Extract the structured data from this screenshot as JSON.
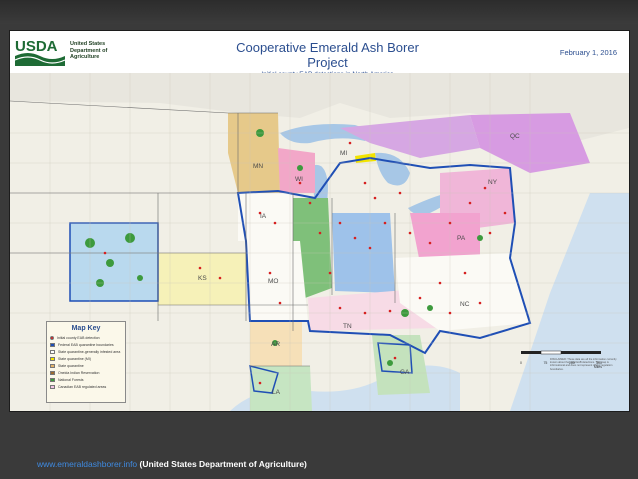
{
  "header": {
    "agency_line1": "United States",
    "agency_line2": "Department of",
    "agency_line3": "Agriculture",
    "logo_text": "USDA",
    "title": "Cooperative Emerald Ash Borer Project",
    "subtitle": "Initial county EAB detections in North America",
    "date": "February 1, 2016"
  },
  "state_labels": [
    "MN",
    "WI",
    "MI",
    "IA",
    "MO",
    "KS",
    "AR",
    "LA",
    "TN",
    "NC",
    "GA",
    "NY",
    "PA",
    "QC"
  ],
  "map_key": {
    "title": "Map Key",
    "items": [
      {
        "label": "Initial county EAB detection",
        "color": "#d62020"
      },
      {
        "label": "Federal EAB quarantine boundaries",
        "color": "#1f4fb5"
      },
      {
        "label": "State quarantine-generally infested area",
        "color": "#ffffff"
      },
      {
        "label": "State quarantine (MI)",
        "color": "#f2e400"
      },
      {
        "label": "State quarantine",
        "color": "#e3b36a"
      },
      {
        "label": "Oneida Indian Reservation",
        "color": "#9c6b2f"
      },
      {
        "label": "National Forests",
        "color": "#3d9a3d"
      },
      {
        "label": "Canadian EAB regulated areas",
        "color": "#f2c6e6"
      }
    ]
  },
  "scale": {
    "labels": [
      "0",
      "75",
      "150",
      "300"
    ],
    "unit": "Miles"
  },
  "disclaimer": "DISCLAIMER: These data are all the information currently known about the initial EAB detections. This map is informational and does not represent official regulation boundaries.",
  "caption": {
    "link": "www.emeraldashborer.info",
    "text": " (United States Department of Agriculture)"
  },
  "colors": {
    "slide_bg": "#3a3a3a",
    "title_blue": "#2b4e8f",
    "usda_green": "#1e6b35",
    "quarantine_blue": "#1f4fb5",
    "detection_red": "#d62020",
    "link_blue": "#3f8ae0"
  }
}
